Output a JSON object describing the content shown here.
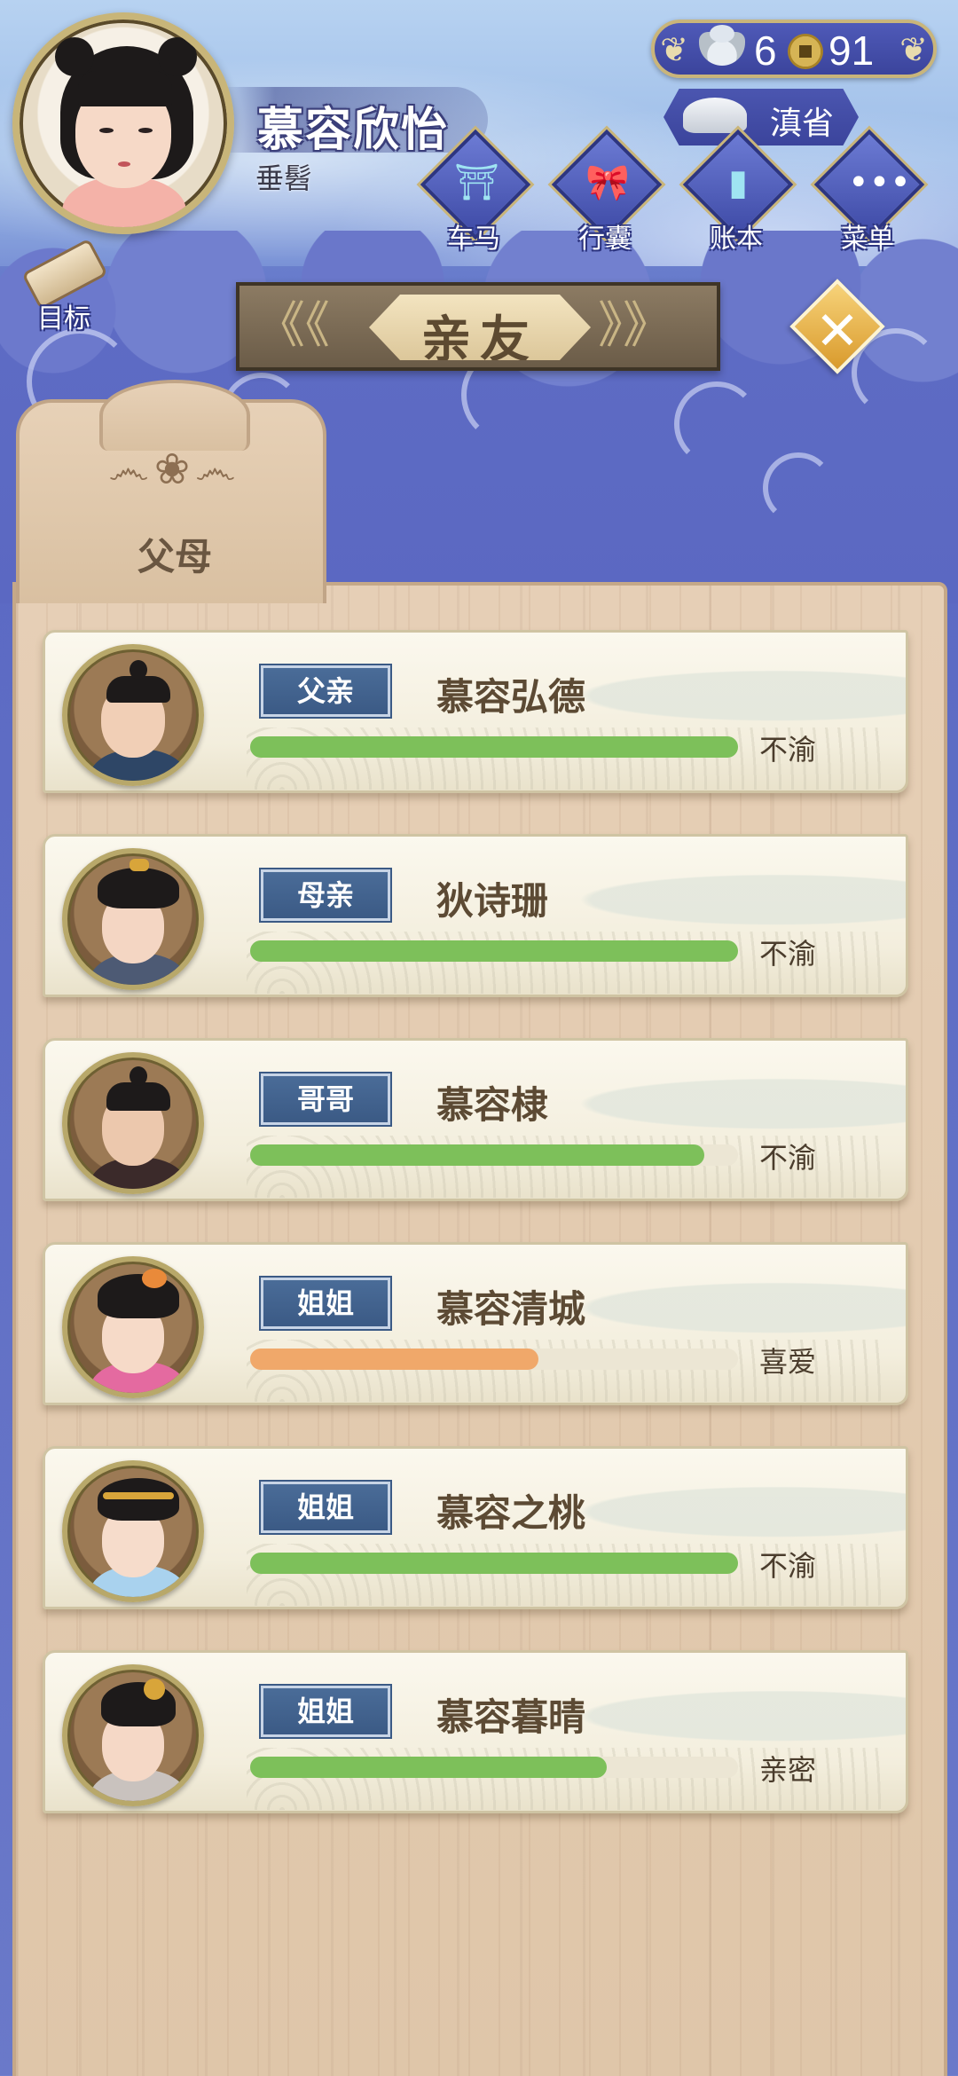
{
  "player": {
    "name": "慕容欣怡",
    "status": "垂髫"
  },
  "currency": {
    "silver": "6",
    "coins": "91"
  },
  "location": "滇省",
  "nav": [
    {
      "label": "车马",
      "icon": "carriage-icon"
    },
    {
      "label": "行囊",
      "icon": "bundle-icon"
    },
    {
      "label": "账本",
      "icon": "ledger-icon"
    },
    {
      "label": "菜单",
      "icon": "menu-dots-icon"
    }
  ],
  "goal_label": "目标",
  "title": "亲友",
  "tab": {
    "label": "父母"
  },
  "colors": {
    "bar_green": "#7dc05a",
    "bar_orange": "#f0a86a",
    "tag_blue": "#3f5f8b"
  },
  "relatives": [
    {
      "role": "父亲",
      "name": "慕容弘德",
      "mood": "不渝",
      "affection": 1.0,
      "bar_color": "green"
    },
    {
      "role": "母亲",
      "name": "狄诗珊",
      "mood": "不渝",
      "affection": 1.0,
      "bar_color": "green"
    },
    {
      "role": "哥哥",
      "name": "慕容棣",
      "mood": "不渝",
      "affection": 0.93,
      "bar_color": "green"
    },
    {
      "role": "姐姐",
      "name": "慕容清城",
      "mood": "喜爱",
      "affection": 0.59,
      "bar_color": "orange"
    },
    {
      "role": "姐姐",
      "name": "慕容之桃",
      "mood": "不渝",
      "affection": 1.0,
      "bar_color": "green"
    },
    {
      "role": "姐姐",
      "name": "慕容暮晴",
      "mood": "亲密",
      "affection": 0.73,
      "bar_color": "green"
    }
  ]
}
